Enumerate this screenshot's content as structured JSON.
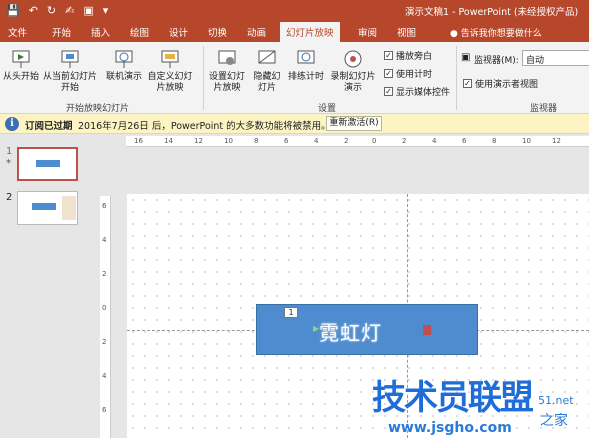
{
  "window": {
    "title": "演示文稿1 - PowerPoint (未经授权产品)",
    "qat_icons": [
      "save-icon",
      "undo-icon",
      "redo-icon",
      "touch-mode-icon",
      "start-slideshow-icon",
      "customize-qat-icon"
    ]
  },
  "tabs": {
    "file": "文件",
    "home": "开始",
    "insert": "插入",
    "design": "绘图",
    "design2": "设计",
    "transitions": "切换",
    "animations": "动画",
    "slideshow": "幻灯片放映",
    "review": "审阅",
    "view": "视图",
    "tell_me": "告诉我你想要做什么"
  },
  "ribbon": {
    "from_beginning": "从头开始",
    "from_current": "从当前幻灯片开始",
    "present_online": "联机演示",
    "custom_show": "自定义幻灯片放映",
    "group_start": "开始放映幻灯片",
    "setup_show": "设置幻灯片放映",
    "hide_slide": "隐藏幻灯片",
    "rehearse": "排练计时",
    "record": "录制幻灯片演示",
    "play_narrations": "播放旁白",
    "use_timings": "使用计时",
    "show_media_controls": "显示媒体控件",
    "group_setup": "设置",
    "monitor_label": "监视器(M):",
    "monitor_value": "自动",
    "presenter_view": "使用演示者视图",
    "group_monitors": "监视器"
  },
  "message_bar": {
    "title": "订阅已过期",
    "text": "2016年7月26日 后，PowerPoint 的大多数功能将被禁用。",
    "button": "重新激活(R)"
  },
  "thumbnails": [
    {
      "number": "1",
      "star": "*"
    },
    {
      "number": "2"
    }
  ],
  "ruler": {
    "h_ticks": [
      "16",
      "14",
      "12",
      "10",
      "8",
      "6",
      "4",
      "2",
      "0",
      "2",
      "4",
      "6",
      "8",
      "10",
      "12"
    ],
    "v_ticks": [
      "6",
      "4",
      "2",
      "0",
      "2",
      "4",
      "6"
    ]
  },
  "slide": {
    "shape_text": "霓虹灯",
    "animation_number": "1"
  },
  "watermark": {
    "brand": "技术员联盟",
    "url": "www.jsgho.com",
    "net": "51.net",
    "home": "之家"
  }
}
